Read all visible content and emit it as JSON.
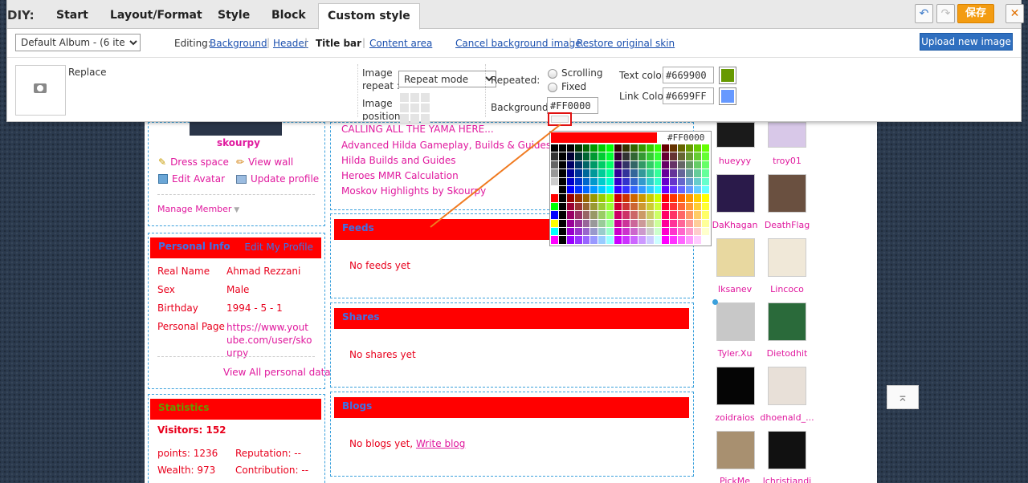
{
  "diy": {
    "label": "DIY:",
    "tabs": [
      "Start",
      "Layout/Format",
      "Style",
      "Block",
      "Custom style"
    ],
    "save_label": "保存",
    "undo_icon": "↶",
    "redo_icon": "↷",
    "close_icon": "✕",
    "album_select": "Default Album - (6 items)",
    "editing_label": "Editing:",
    "editing_links": {
      "background": "Background",
      "header": "Header",
      "title_bar": "Title bar",
      "content_area": "Content area"
    },
    "cancel_bg": "Cancel background image",
    "restore_skin": "Restore original skin",
    "upload_button": "Upload new image",
    "replace_label": "Replace",
    "image_repeat_label": "Image repeat :",
    "repeat_select": "Repeat mode",
    "image_position_label": "Image position:",
    "repeated_label": "Repeated:",
    "scrolling_label": "Scrolling",
    "fixed_label": "Fixed",
    "background_label": "Background",
    "background_value": "#FF0000",
    "text_color_label": "Text color:",
    "text_color_value": "#669900",
    "link_color_label": "Link Color:",
    "link_color_value": "#6699FF",
    "colors": {
      "text": "#669900",
      "link": "#6699FF",
      "background": "#FF0000"
    }
  },
  "picker": {
    "value": "#FF0000"
  },
  "left": {
    "username": "skourpy",
    "actions": [
      "Dress space",
      "View wall",
      "Edit Avatar",
      "Update profile"
    ],
    "manage_member": "Manage Member",
    "personal_info": {
      "title": "Personal Info",
      "edit_link": "Edit My Profile",
      "rows": [
        {
          "k": "Real Name",
          "v": "Ahmad Rezzani"
        },
        {
          "k": "Sex",
          "v": "Male"
        },
        {
          "k": "Birthday",
          "v": "1994 - 5 - 1"
        },
        {
          "k": "Personal Page",
          "v": "https://www.youtube.com/user/skourpy"
        }
      ],
      "view_all": "View All personal data"
    },
    "statistics": {
      "title": "Statistics",
      "visitors_label": "Visitors:",
      "visitors_value": "152",
      "points": "points: 1236",
      "reputation": "Reputation: --",
      "wealth": "Wealth: 973",
      "contribution": "Contribution: --"
    }
  },
  "middle": {
    "cut_link": "CALLING ALL THE YAMA HERE...",
    "links": [
      "Advanced Hilda Gameplay, Builds & Guides",
      "Hilda Builds and Guides",
      "Heroes MMR Calculation",
      "Moskov Highlights by Skourpy"
    ],
    "feeds": {
      "title": "Feeds",
      "empty": "No feeds yet"
    },
    "shares": {
      "title": "Shares",
      "empty": "No shares yet"
    },
    "blogs": {
      "title": "Blogs",
      "empty": "No blogs yet,",
      "write": "Write blog"
    }
  },
  "right": {
    "members": [
      "hueyyy",
      "troy01",
      "DaKhagan",
      "DeathFlag",
      "Iksanev",
      "Lincoco",
      "Tyler.Xu",
      "Dietodhit",
      "zoidraios",
      "dhoenald_...",
      "PickMe",
      "lchristiandi"
    ]
  },
  "float": {
    "top_icon": "⌅"
  }
}
